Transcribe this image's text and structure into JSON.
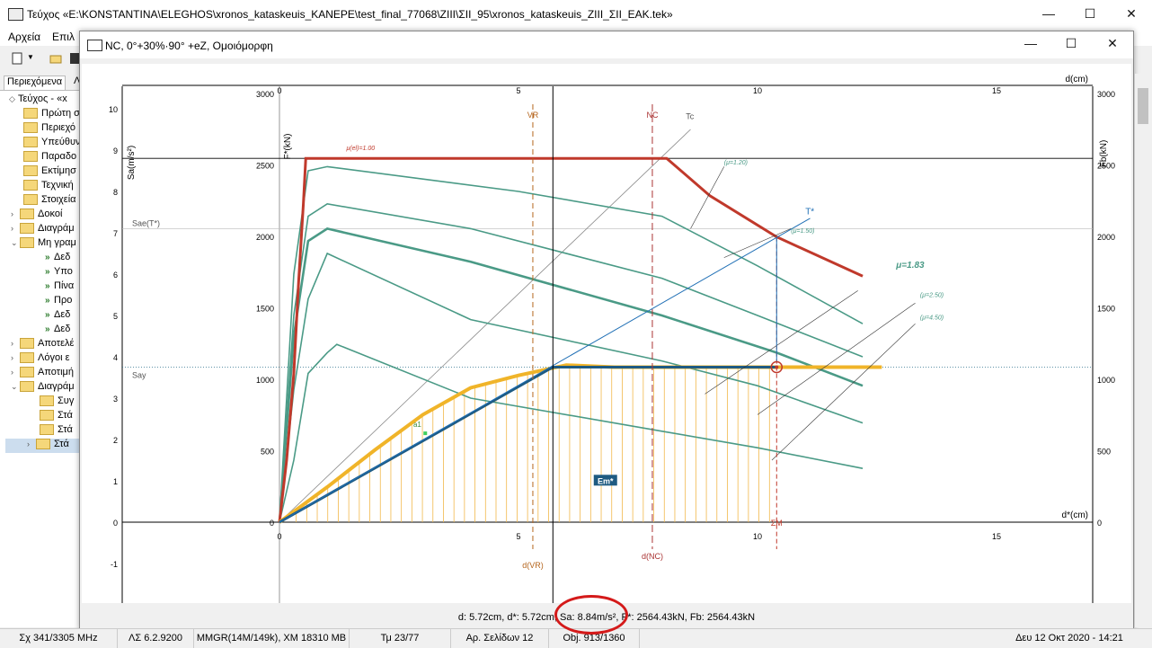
{
  "app": {
    "title": "Τεύχος «E:\\KONSTANTINA\\ELEGHOS\\xronos_kataskeuis_KANEPE\\test_final_77068\\ZIII\\ΣΙΙ_95\\xronos_kataskeuis_ZIII_ΣΙΙ_EAK.tek»",
    "minimize": "—",
    "maximize": "☐",
    "close": "✕"
  },
  "menu": {
    "file": "Αρχεία",
    "edit": "Επιλ"
  },
  "side": {
    "tab_label": "Περιεχόμενα",
    "tab2_label": "Λ",
    "items": [
      {
        "label": "Τεύχος - «x",
        "kind": "root"
      },
      {
        "label": "Πρώτη σ",
        "kind": "folder"
      },
      {
        "label": "Περιεχό",
        "kind": "folder"
      },
      {
        "label": "Υπεύθυν",
        "kind": "folder"
      },
      {
        "label": "Παραδο",
        "kind": "folder"
      },
      {
        "label": "Εκτίμησ",
        "kind": "folder"
      },
      {
        "label": "Τεχνική",
        "kind": "folder"
      },
      {
        "label": "Στοιχεία",
        "kind": "folder"
      },
      {
        "label": "Δοκοί",
        "kind": "folder-collapsed"
      },
      {
        "label": "Διαγράμ",
        "kind": "folder-collapsed"
      },
      {
        "label": "Μη γραμ",
        "kind": "folder-open"
      },
      {
        "label": "Δεδ",
        "kind": "leaf"
      },
      {
        "label": "Υπο",
        "kind": "leaf"
      },
      {
        "label": "Πίνα",
        "kind": "leaf"
      },
      {
        "label": "Προ",
        "kind": "leaf"
      },
      {
        "label": "Δεδ",
        "kind": "leaf"
      },
      {
        "label": "Δεδ",
        "kind": "leaf"
      },
      {
        "label": "Αποτελέ",
        "kind": "folder-collapsed"
      },
      {
        "label": "Λόγοι ε",
        "kind": "folder-collapsed"
      },
      {
        "label": "Αποτιμή",
        "kind": "folder-collapsed"
      },
      {
        "label": "Διαγράμ",
        "kind": "folder-open"
      },
      {
        "label": "Συγ",
        "kind": "sub"
      },
      {
        "label": "Στά",
        "kind": "sub"
      },
      {
        "label": "Στά",
        "kind": "sub"
      },
      {
        "label": "Στά",
        "kind": "sub-selected"
      }
    ]
  },
  "child_window": {
    "title": "NC, 0°+30%·90° +eZ, Ομοιόμορφη",
    "status": "d: 5.72cm, d*: 5.72cm, Sa: 8.84m/s², F*: 2564.43kN, Fb: 2564.43kN"
  },
  "statusbar": {
    "cpu": "Σχ 341/3305 MHz",
    "version": "ΛΣ 6.2.9200",
    "memory": "MMGR(14M/149k), XM 18310 MB",
    "section": "Τμ 23/77",
    "pages": "Αρ. Σελίδων 12",
    "objects": "Obj. 913/1360",
    "datetime": "Δευ 12 Οκτ 2020 - 14:21"
  },
  "chart_data": {
    "type": "line",
    "x_label_top": "d(cm)",
    "x_label_bottom": "d*(cm)",
    "y_left_outer_label": "Sa(m/s²)",
    "y_left_inner_label": "F*(kN)",
    "y_right_label": "Fb(kN)",
    "x_ticks": [
      "0",
      "5",
      "10",
      "15"
    ],
    "sa_ticks": [
      "-1",
      "0",
      "1",
      "2",
      "3",
      "4",
      "5",
      "6",
      "7",
      "8",
      "9",
      "10"
    ],
    "f_ticks": [
      "0",
      "500",
      "1000",
      "1500",
      "2000",
      "2500",
      "3000"
    ],
    "xlim": [
      0,
      17
    ],
    "sa_lim": [
      -1,
      10.5
    ],
    "f_lim": [
      0,
      3000
    ],
    "annotations": {
      "vr": "VR",
      "nc": "NC",
      "dvr": "d(VR)",
      "dnc": "d(NC)",
      "tc": "Tc",
      "tstar": "T*",
      "sae": "Sae(T*)",
      "say": "Say",
      "sm": "ΣΜ",
      "em": "Em*",
      "a1": "a1",
      "mu_el": "μ(el)=1.00",
      "mu120": "(μ=1.20)",
      "mu150": "(μ=1.50)",
      "mu183": "μ=1.83",
      "mu250": "(μ=2.50)",
      "mu450": "(μ=4.50)"
    },
    "markers": {
      "d_vr": 5.3,
      "d_nc": 7.8,
      "d_current": 5.72,
      "d_sm": 10.4
    },
    "elastic_curve": [
      [
        0,
        0
      ],
      [
        0.15,
        1.5
      ],
      [
        0.3,
        3.6
      ],
      [
        0.4,
        5.8
      ],
      [
        0.5,
        7.7
      ],
      [
        0.55,
        8.8
      ],
      [
        8.1,
        8.8
      ],
      [
        9,
        7.9
      ],
      [
        10.4,
        6.9
      ],
      [
        12.2,
        5.95
      ]
    ],
    "capacity_curve": [
      [
        0,
        0
      ],
      [
        1,
        0.85
      ],
      [
        2,
        1.75
      ],
      [
        3,
        2.6
      ],
      [
        4,
        3.25
      ],
      [
        5,
        3.55
      ],
      [
        6,
        3.8
      ],
      [
        7,
        3.75
      ],
      [
        8,
        3.75
      ],
      [
        9,
        3.75
      ],
      [
        10,
        3.75
      ],
      [
        10.4,
        3.75
      ],
      [
        12.6,
        3.75
      ]
    ],
    "bilinear": [
      [
        0,
        0
      ],
      [
        5.72,
        3.75
      ],
      [
        10.4,
        3.75
      ]
    ],
    "demand_mu120": [
      [
        0,
        0
      ],
      [
        0.3,
        6
      ],
      [
        0.6,
        8.5
      ],
      [
        1,
        8.6
      ],
      [
        5,
        8.0
      ],
      [
        8,
        7.4
      ],
      [
        10,
        6.2
      ],
      [
        12.2,
        4.8
      ]
    ],
    "demand_mu150": [
      [
        0,
        0
      ],
      [
        0.3,
        5
      ],
      [
        0.6,
        7.4
      ],
      [
        1,
        7.7
      ],
      [
        4,
        7.1
      ],
      [
        8,
        5.9
      ],
      [
        10,
        5.0
      ],
      [
        12.2,
        4.0
      ]
    ],
    "demand_mu183": [
      [
        0,
        0
      ],
      [
        0.3,
        4.5
      ],
      [
        0.6,
        6.8
      ],
      [
        1,
        7.1
      ],
      [
        4,
        6.3
      ],
      [
        8,
        5.0
      ],
      [
        10.4,
        4.1
      ],
      [
        12.2,
        3.3
      ]
    ],
    "demand_mu250": [
      [
        0,
        0
      ],
      [
        0.3,
        3.2
      ],
      [
        0.6,
        5.4
      ],
      [
        1,
        6.5
      ],
      [
        4,
        4.9
      ],
      [
        8,
        3.9
      ],
      [
        10,
        3.3
      ],
      [
        12.2,
        2.4
      ]
    ],
    "demand_mu450": [
      [
        0,
        0
      ],
      [
        0.3,
        1.5
      ],
      [
        0.6,
        3.6
      ],
      [
        1,
        4.1
      ],
      [
        1.2,
        4.3
      ],
      [
        4,
        3.0
      ],
      [
        8,
        2.2
      ],
      [
        10,
        1.8
      ],
      [
        12.2,
        1.3
      ]
    ],
    "colors": {
      "elastic": "#c0392b",
      "demand": "#4a9a86",
      "capacity": "#f0b429",
      "bilinear": "#1f5b82",
      "hatch": "#f2b84b",
      "period": "#1f6fb5"
    }
  }
}
